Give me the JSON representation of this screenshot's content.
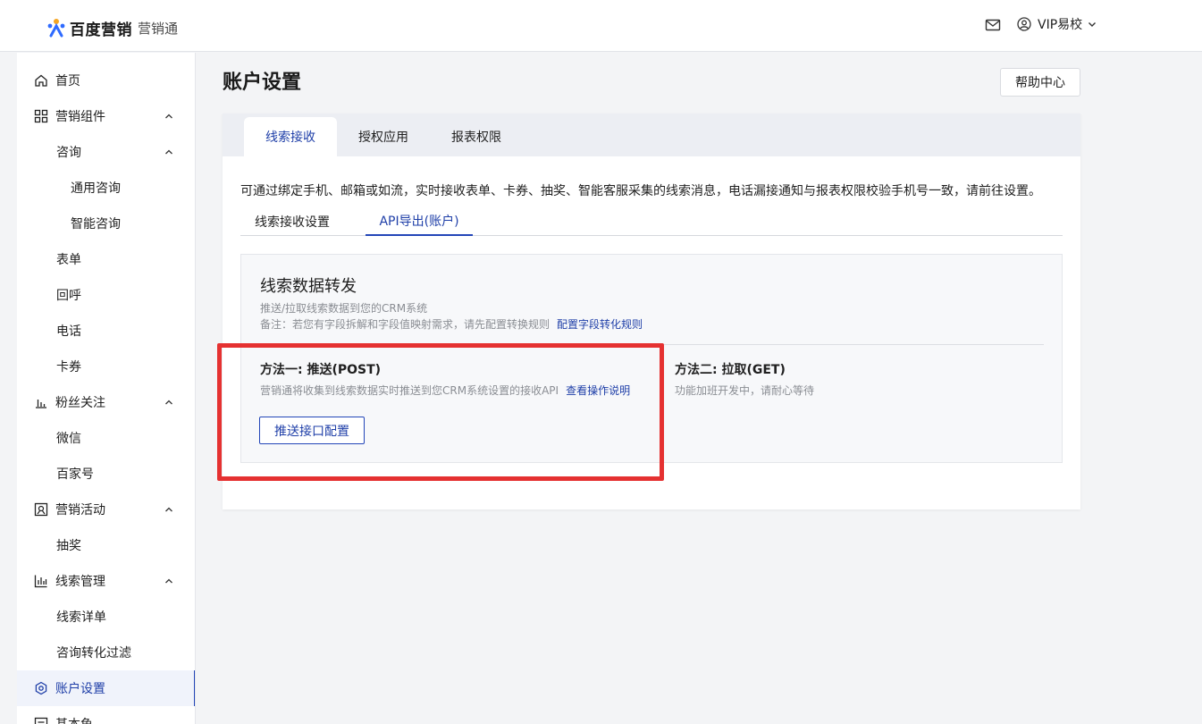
{
  "header": {
    "logo_brand": "百度营销",
    "logo_sub": "营销通",
    "user_name": "VIP易校"
  },
  "sidebar": {
    "items": [
      {
        "label": "首页"
      },
      {
        "label": "营销组件"
      },
      {
        "label": "咨询"
      },
      {
        "label": "通用咨询"
      },
      {
        "label": "智能咨询"
      },
      {
        "label": "表单"
      },
      {
        "label": "回呼"
      },
      {
        "label": "电话"
      },
      {
        "label": "卡券"
      },
      {
        "label": "粉丝关注"
      },
      {
        "label": "微信"
      },
      {
        "label": "百家号"
      },
      {
        "label": "营销活动"
      },
      {
        "label": "抽奖"
      },
      {
        "label": "线索管理"
      },
      {
        "label": "线索详单"
      },
      {
        "label": "咨询转化过滤"
      },
      {
        "label": "账户设置"
      },
      {
        "label": "基本鱼"
      }
    ],
    "active": "账户设置"
  },
  "main": {
    "title": "账户设置",
    "help_button": "帮助中心",
    "tabs": [
      {
        "label": "线索接收",
        "active": true
      },
      {
        "label": "授权应用",
        "active": false
      },
      {
        "label": "报表权限",
        "active": false
      }
    ],
    "intro": "可通过绑定手机、邮箱或如流，实时接收表单、卡券、抽奖、智能客服采集的线索消息，电话漏接通知与报表权限校验手机号一致，请前往设置。",
    "subtabs": [
      {
        "label": "线索接收设置",
        "active": false
      },
      {
        "label": "API导出(账户)",
        "active": true
      }
    ],
    "forward": {
      "title": "线索数据转发",
      "desc1": "推送/拉取线索数据到您的CRM系统",
      "desc2": "备注：若您有字段拆解和字段值映射需求，请先配置转换规则",
      "desc2_link": "配置字段转化规则",
      "method1": {
        "title": "方法一: 推送(POST)",
        "desc": "营销通将收集到线索数据实时推送到您CRM系统设置的接收API",
        "link": "查看操作说明",
        "button": "推送接口配置"
      },
      "method2": {
        "title": "方法二: 拉取(GET)",
        "desc": "功能加班开发中，请耐心等待"
      }
    }
  },
  "colors": {
    "accent": "#2346b8",
    "highlight": "#e53131"
  }
}
